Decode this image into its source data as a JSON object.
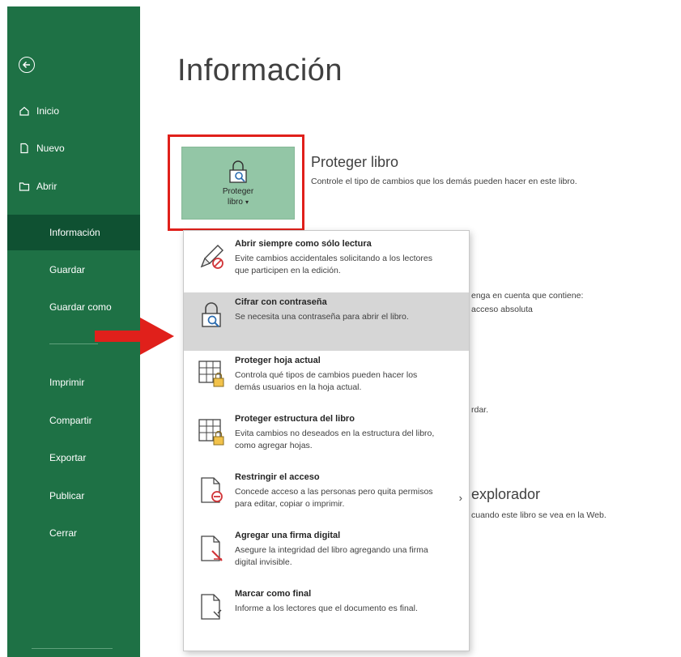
{
  "sidebar": {
    "top_items": [
      {
        "label": "Inicio",
        "icon": "home-icon"
      },
      {
        "label": "Nuevo",
        "icon": "new-file-icon"
      },
      {
        "label": "Abrir",
        "icon": "open-folder-icon"
      }
    ],
    "items": [
      {
        "label": "Información",
        "active": true
      },
      {
        "label": "Guardar"
      },
      {
        "label": "Guardar como"
      },
      {
        "label": "Imprimir"
      },
      {
        "label": "Compartir"
      },
      {
        "label": "Exportar"
      },
      {
        "label": "Publicar"
      },
      {
        "label": "Cerrar"
      }
    ]
  },
  "main": {
    "title": "Información",
    "protect_button": {
      "line1": "Proteger",
      "line2": "libro"
    },
    "protect_heading": "Proteger libro",
    "protect_description": "Controle el tipo de cambios que los demás pueden hacer en este libro.",
    "partial_texts": {
      "t1": "enga en cuenta que contiene:",
      "t2": "acceso absoluta",
      "t3": "rdar.",
      "t4": "explorador",
      "t5": "cuando este libro se vea en la Web."
    }
  },
  "menu": {
    "items": [
      {
        "title": "Abrir siempre como sólo lectura",
        "desc": "Evite cambios accidentales solicitando a los lectores que participen en la edición.",
        "icon": "read-only-pencil-icon"
      },
      {
        "title": "Cifrar con contraseña",
        "desc": "Se necesita una contraseña para abrir el libro.",
        "icon": "encrypt-lock-icon"
      },
      {
        "title": "Proteger hoja actual",
        "desc": "Controla qué tipos de cambios pueden hacer los demás usuarios en la hoja actual.",
        "icon": "protect-sheet-icon"
      },
      {
        "title": "Proteger estructura del libro",
        "desc": "Evita cambios no deseados en la estructura del libro, como agregar hojas.",
        "icon": "protect-structure-icon"
      },
      {
        "title": "Restringir el acceso",
        "desc": "Concede acceso a las personas pero quita permisos para editar, copiar o imprimir.",
        "icon": "restrict-access-icon"
      },
      {
        "title": "Agregar una firma digital",
        "desc": "Asegure la integridad del libro agregando una firma digital invisible.",
        "icon": "digital-signature-icon"
      },
      {
        "title": "Marcar como final",
        "desc": "Informe a los lectores que el documento es final.",
        "icon": "mark-final-icon"
      }
    ]
  },
  "colors": {
    "sidebar": "#1e7145",
    "sidebar_active": "#0f5132",
    "accent_red": "#e0201b",
    "button": "#93c6a6"
  }
}
